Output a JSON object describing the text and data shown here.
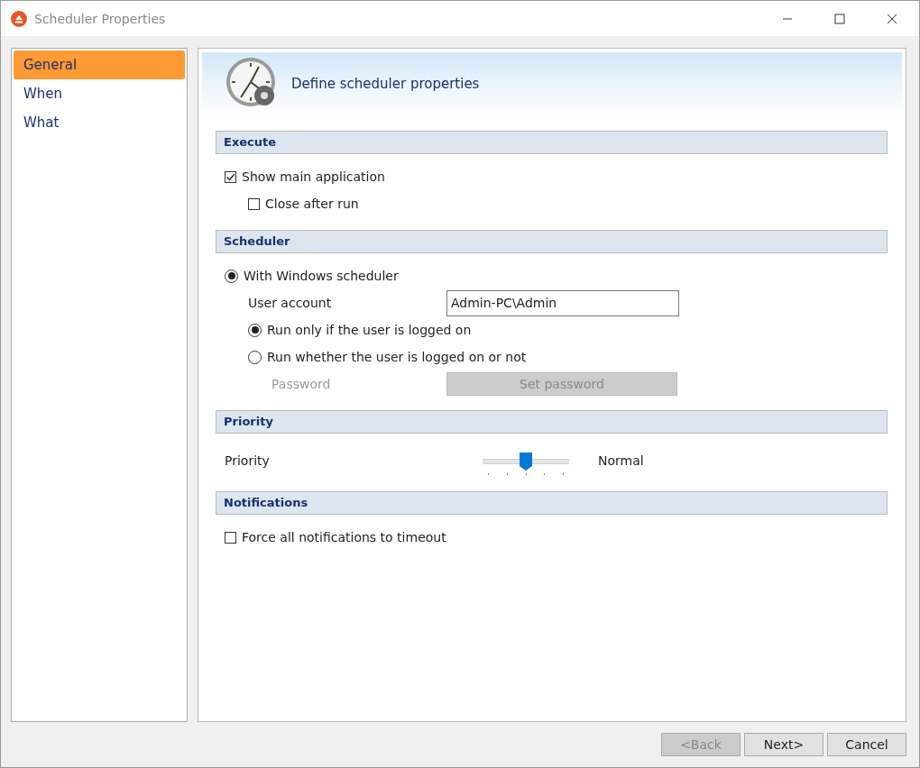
{
  "window": {
    "title": "Scheduler Properties"
  },
  "sidebar": {
    "items": [
      {
        "label": "General",
        "selected": true
      },
      {
        "label": "When",
        "selected": false
      },
      {
        "label": "What",
        "selected": false
      }
    ]
  },
  "header": {
    "title": "Define scheduler properties"
  },
  "sections": [
    {
      "title": "Execute",
      "rows": [
        {
          "kind": "checkbox",
          "label": "Show main application",
          "checked": true,
          "indent": false
        },
        {
          "kind": "checkbox",
          "label": "Close after run",
          "checked": false,
          "indent": true
        }
      ]
    },
    {
      "title": "Scheduler",
      "rows": [
        {
          "kind": "radio",
          "label": "With Windows scheduler",
          "selected": true,
          "indent": false
        },
        {
          "kind": "field",
          "label": "User account",
          "value": "Admin-PC\\Admin"
        },
        {
          "kind": "radio",
          "label": "Run only if the user is logged on",
          "selected": true,
          "indent": true
        },
        {
          "kind": "radio",
          "label": "Run whether the user is logged on or not",
          "selected": false,
          "indent": true
        },
        {
          "kind": "action",
          "label": "Password",
          "button": "Set password",
          "disabled": true
        }
      ]
    },
    {
      "title": "Priority",
      "rows": [
        {
          "kind": "slider",
          "label": "Priority",
          "level": 0.5,
          "reading": "Normal"
        }
      ]
    },
    {
      "title": "Notifications",
      "rows": [
        {
          "kind": "checkbox",
          "label": "Force all notifications to timeout",
          "checked": false,
          "indent": false
        }
      ]
    }
  ],
  "buttons": [
    {
      "label": "<Back",
      "disabled": true
    },
    {
      "label": "Next>",
      "disabled": false
    },
    {
      "label": "Cancel",
      "disabled": false
    }
  ]
}
